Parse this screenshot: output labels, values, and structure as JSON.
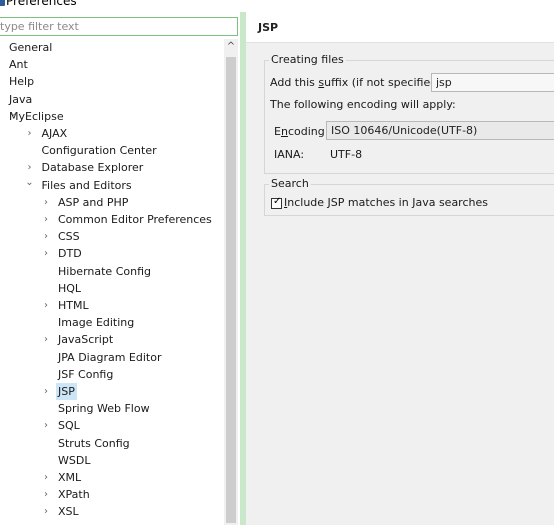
{
  "window": {
    "title": "Preferences"
  },
  "sidebar": {
    "filter_placeholder": "type filter text",
    "items": [
      {
        "label": "General",
        "level": 0,
        "expander": ""
      },
      {
        "label": "Ant",
        "level": 0,
        "expander": ""
      },
      {
        "label": "Help",
        "level": 0,
        "expander": ""
      },
      {
        "label": "Java",
        "level": 0,
        "expander": ""
      },
      {
        "label": "MyEclipse",
        "level": 0,
        "expander": "⌄"
      },
      {
        "label": "AJAX",
        "level": 1,
        "expander": "›"
      },
      {
        "label": "Configuration Center",
        "level": 1,
        "expander": ""
      },
      {
        "label": "Database Explorer",
        "level": 1,
        "expander": "›"
      },
      {
        "label": "Files and Editors",
        "level": 1,
        "expander": "⌄"
      },
      {
        "label": "ASP and PHP",
        "level": 2,
        "expander": "›"
      },
      {
        "label": "Common Editor Preferences",
        "level": 2,
        "expander": "›"
      },
      {
        "label": "CSS",
        "level": 2,
        "expander": "›"
      },
      {
        "label": "DTD",
        "level": 2,
        "expander": "›"
      },
      {
        "label": "Hibernate Config",
        "level": 2,
        "expander": ""
      },
      {
        "label": "HQL",
        "level": 2,
        "expander": ""
      },
      {
        "label": "HTML",
        "level": 2,
        "expander": "›"
      },
      {
        "label": "Image Editing",
        "level": 2,
        "expander": ""
      },
      {
        "label": "JavaScript",
        "level": 2,
        "expander": "›"
      },
      {
        "label": "JPA Diagram Editor",
        "level": 2,
        "expander": ""
      },
      {
        "label": "JSF Config",
        "level": 2,
        "expander": ""
      },
      {
        "label": "JSP",
        "level": 2,
        "expander": "›",
        "selected": true
      },
      {
        "label": "Spring Web Flow",
        "level": 2,
        "expander": ""
      },
      {
        "label": "SQL",
        "level": 2,
        "expander": "›"
      },
      {
        "label": "Struts Config",
        "level": 2,
        "expander": ""
      },
      {
        "label": "WSDL",
        "level": 2,
        "expander": ""
      },
      {
        "label": "XML",
        "level": 2,
        "expander": "›"
      },
      {
        "label": "XPath",
        "level": 2,
        "expander": "›"
      },
      {
        "label": "XSL",
        "level": 2,
        "expander": "›"
      }
    ]
  },
  "page": {
    "title": "JSP",
    "creating_files": {
      "legend": "Creating files",
      "suffix_label_pre": "Add this ",
      "suffix_label_mnemonic": "s",
      "suffix_label_post": "uffix (if not specified):",
      "suffix_value": "jsp",
      "encoding_note": "The following encoding will apply:",
      "encoding_label_pre": "E",
      "encoding_label_mnemonic": "n",
      "encoding_label_post": "coding:",
      "encoding_value": "ISO 10646/Unicode(UTF-8)",
      "iana_label": "IANA:",
      "iana_value": "UTF-8"
    },
    "search": {
      "legend": "Search",
      "checkbox_checked": true,
      "checkbox_label_mnemonic": "I",
      "checkbox_label_post": "nclude JSP matches in Java searches"
    }
  },
  "colors": {
    "accent_green": "#7ec07e",
    "selection": "#cde6f7"
  },
  "icons": {
    "expand": "chevron-right-icon",
    "collapse": "chevron-down-icon",
    "scroll_up": "arrow-up-icon"
  }
}
